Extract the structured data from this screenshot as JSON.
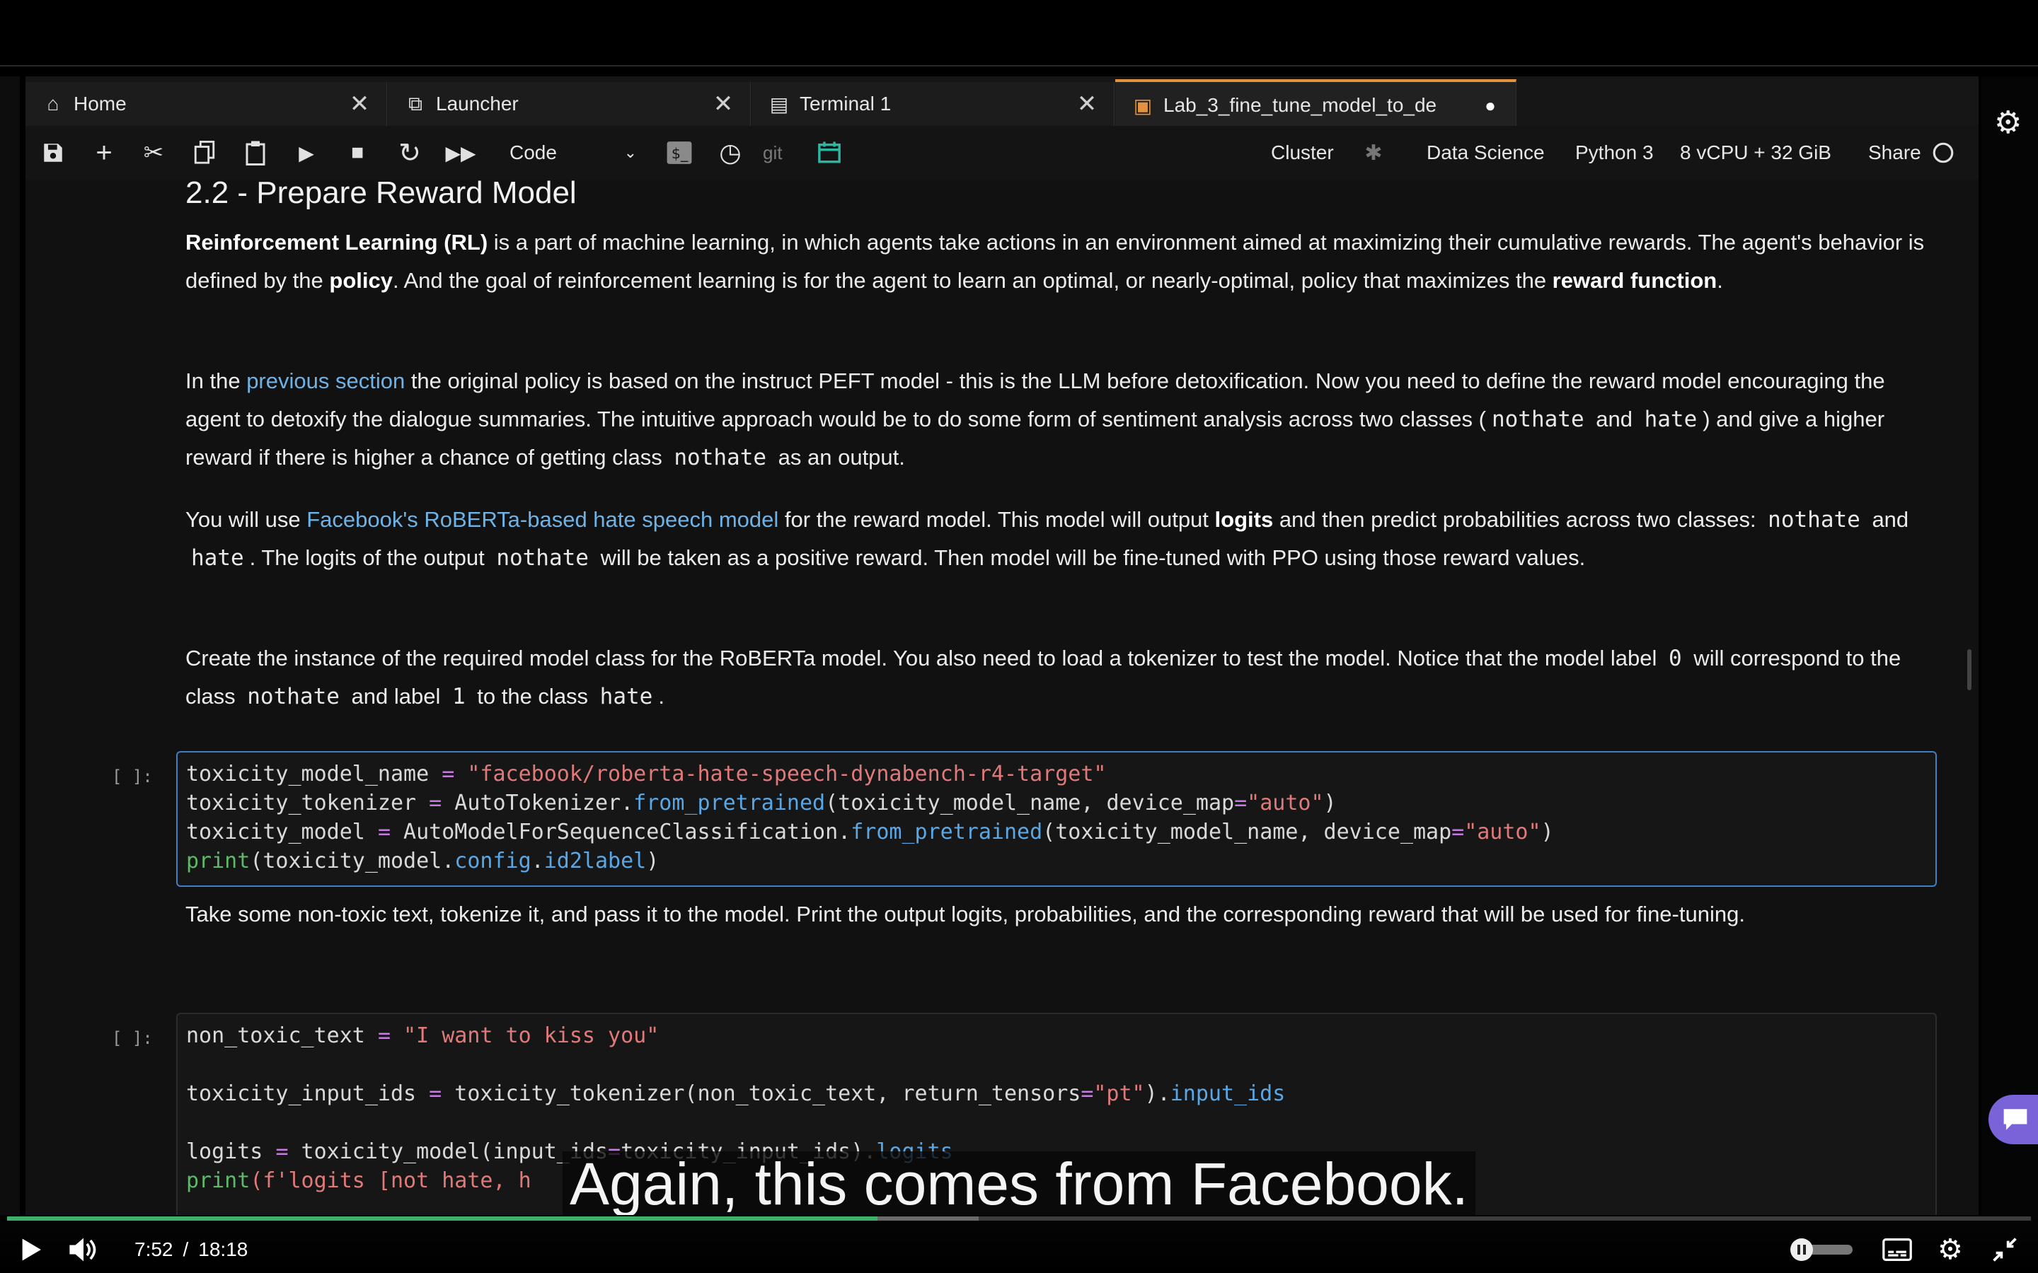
{
  "tabs": [
    {
      "icon": "home-icon",
      "glyph": "⌂",
      "label": "Home",
      "close": "✕"
    },
    {
      "icon": "launcher-icon",
      "glyph": "⧉",
      "label": "Launcher",
      "close": "✕"
    },
    {
      "icon": "terminal-icon",
      "glyph": "▤",
      "label": "Terminal 1",
      "close": "✕"
    },
    {
      "icon": "notebook-icon",
      "glyph": "▣",
      "label": "Lab_3_fine_tune_model_to_de",
      "close": "●"
    }
  ],
  "toolbar": {
    "cell_type": "Code",
    "git_label": "git",
    "cluster": "Cluster",
    "kernel_image": "Data Science",
    "kernel": "Python 3",
    "instance": "8 vCPU + 32 GiB",
    "share": "Share"
  },
  "notebook": {
    "heading": "2.2 - Prepare Reward Model",
    "p1": {
      "rl_bold": "Reinforcement Learning (RL)",
      "t1": " is a part of machine learning, in which agents take actions in an environment aimed at maximizing their cumulative rewards. The agent's behavior is defined by the ",
      "policy_bold": "policy",
      "t2": ". And the goal of reinforcement learning is for the agent to learn an optimal, or nearly-optimal, policy that maximizes the ",
      "reward_bold": "reward function",
      "t3": "."
    },
    "p2": {
      "t1": "In the ",
      "link": "previous section",
      "t2": " the original policy is based on the instruct PEFT model - this is the LLM before detoxification. Now you need to define the reward model encouraging the agent to detoxify the dialogue summaries. The intuitive approach would be to do some form of sentiment analysis across two classes (",
      "c1": "nothate",
      "t3": " and ",
      "c2": "hate",
      "t4": ") and give a higher reward if there is higher a chance of getting class ",
      "c3": "nothate",
      "t5": " as an output."
    },
    "p3": {
      "t1": "You will use ",
      "link": "Facebook's RoBERTa-based hate speech model",
      "t2": " for the reward model. This model will output ",
      "logits_bold": "logits",
      "t3": " and then predict probabilities across two classes: ",
      "c1": "nothate",
      "t4": " and ",
      "c2": "hate",
      "t5": ". The logits of the output ",
      "c3": "nothate",
      "t6": " will be taken as a positive reward. Then model will be fine-tuned with PPO using those reward values."
    },
    "p4": {
      "t1": "Create the instance of the required model class for the RoBERTa model. You also need to load a tokenizer to test the model. Notice that the model label ",
      "c1": "0",
      "t2": " will correspond to the class ",
      "c2": "nothate",
      "t3": " and label ",
      "c3": "1",
      "t4": " to the class ",
      "c4": "hate",
      "t5": "."
    },
    "cell1_prompt": "[ ]:",
    "cell1": {
      "l1_var": "toxicity_model_name",
      "l1_op": " = ",
      "l1_str": "\"facebook/roberta-hate-speech-dynabench-r4-target\"",
      "l2_a": "toxicity_tokenizer ",
      "l2_op": "=",
      "l2_b": " AutoTokenizer.",
      "l2_fn": "from_pretrained",
      "l2_c": "(toxicity_model_name, device_map",
      "l2_op2": "=",
      "l2_str": "\"auto\"",
      "l2_d": ")",
      "l3_a": "toxicity_model ",
      "l3_op": "=",
      "l3_b": " AutoModelForSequenceClassification.",
      "l3_fn": "from_pretrained",
      "l3_c": "(toxicity_model_name, device_map",
      "l3_op2": "=",
      "l3_str": "\"auto\"",
      "l3_d": ")",
      "l4_kw": "print",
      "l4_a": "(toxicity_model.",
      "l4_fn1": "config",
      "l4_b": ".",
      "l4_fn2": "id2label",
      "l4_c": ")"
    },
    "p5": "Take some non-toxic text, tokenize it, and pass it to the model. Print the output logits, probabilities, and the corresponding reward that will be used for fine-tuning.",
    "cell2_prompt": "[ ]:",
    "cell2": {
      "l1_a": "non_toxic_text ",
      "l1_op": "=",
      "l1_str": " \"I want to kiss you\"",
      "l2_a": "toxicity_input_ids ",
      "l2_op": "=",
      "l2_b": " toxicity_tokenizer(non_toxic_text, return_tensors",
      "l2_op2": "=",
      "l2_str": "\"pt\"",
      "l2_c": ").",
      "l2_fn": "input_ids",
      "l3_a": "logits ",
      "l3_op": "=",
      "l3_b": " toxicity_model(input_ids",
      "l3_op2": "=",
      "l3_c": "toxicity_input_ids).",
      "l3_fn": "logits",
      "l4_kw": "print",
      "l4_str": "(f'logits [not hate, h"
    }
  },
  "subtitle": "Again, this comes from Facebook.",
  "player": {
    "current_time": "7:52",
    "separator": "/",
    "duration": "18:18",
    "progress": 0.43,
    "buffered": 0.48
  }
}
